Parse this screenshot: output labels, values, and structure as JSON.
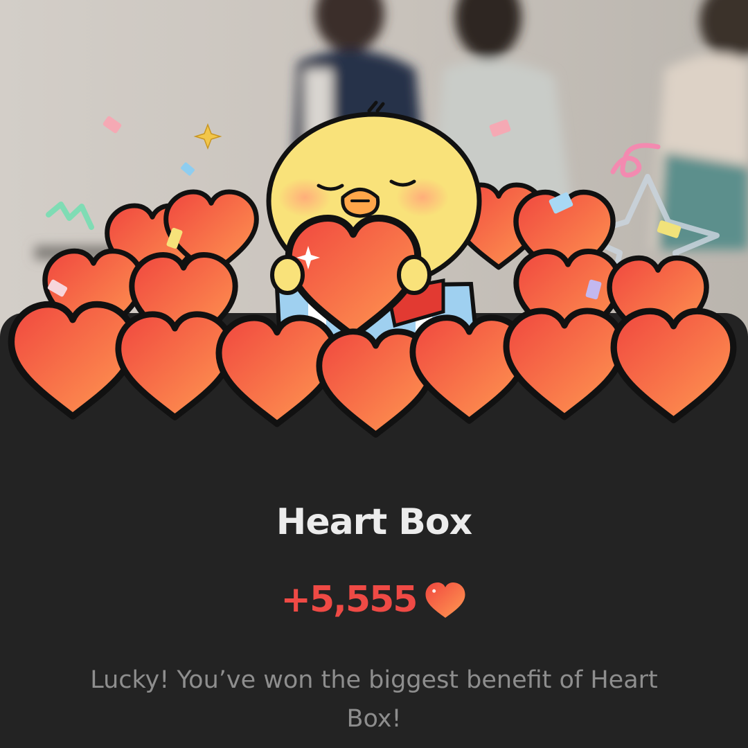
{
  "popup": {
    "title": "Heart Box",
    "reward_amount": "+5,555",
    "reward_icon": "heart-icon",
    "message": "Lucky! You’ve won the biggest benefit of Heart Box!"
  },
  "colors": {
    "sheet_background": "#232323",
    "title_text": "#ececec",
    "amount_text": "#ef4a45",
    "message_text": "#8e8e8e",
    "heart_gradient_start": "#f0473f",
    "heart_gradient_end": "#ff9a52",
    "chick_body": "#f9e27a"
  },
  "illustration": {
    "subject": "chick-with-heart-box",
    "decorations": [
      "confetti-icon",
      "sparkle-icon",
      "star-outline-icon"
    ]
  }
}
